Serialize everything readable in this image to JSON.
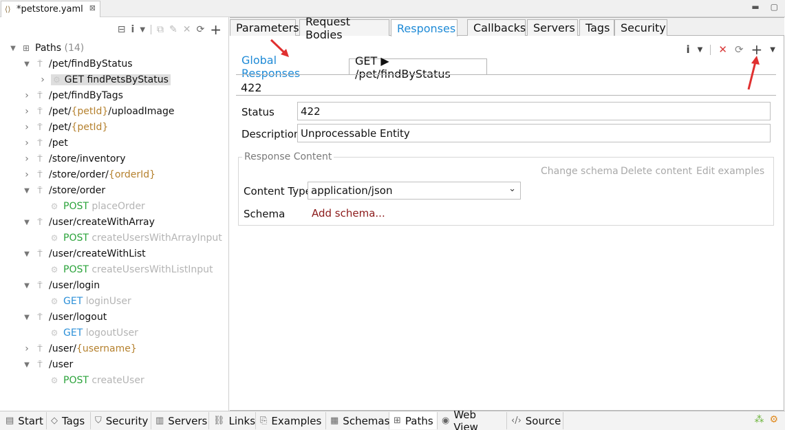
{
  "editor": {
    "tab_title": "*petstore.yaml",
    "close_glyph": "⊠"
  },
  "left": {
    "toolbar": [
      "collapse-all-icon",
      "info-icon",
      "dropdown-icon",
      "copy-icon",
      "edit-icon",
      "delete-icon",
      "refresh-icon",
      "add-icon"
    ],
    "root": {
      "label": "Paths",
      "count": "(14)"
    },
    "rows": [
      {
        "path_a": "/pet/findByStatus",
        "param": "",
        "path_b": "",
        "expanded": true
      },
      {
        "method": "GET",
        "op": "findPetsByStatus",
        "selected": true
      },
      {
        "path_a": "/pet/findByTags",
        "param": "",
        "path_b": ""
      },
      {
        "path_a": "/pet/",
        "param": "{petId}",
        "path_b": "/uploadImage"
      },
      {
        "path_a": "/pet/",
        "param": "{petId}",
        "path_b": ""
      },
      {
        "path_a": "/pet",
        "param": "",
        "path_b": ""
      },
      {
        "path_a": "/store/inventory",
        "param": "",
        "path_b": ""
      },
      {
        "path_a": "/store/order/",
        "param": "{orderId}",
        "path_b": ""
      },
      {
        "path_a": "/store/order",
        "param": "",
        "path_b": "",
        "expanded": true
      },
      {
        "method": "POST",
        "op": "placeOrder"
      },
      {
        "path_a": "/user/createWithArray",
        "param": "",
        "path_b": "",
        "expanded": true
      },
      {
        "method": "POST",
        "op": "createUsersWithArrayInput"
      },
      {
        "path_a": "/user/createWithList",
        "param": "",
        "path_b": "",
        "expanded": true
      },
      {
        "method": "POST",
        "op": "createUsersWithListInput"
      },
      {
        "path_a": "/user/login",
        "param": "",
        "path_b": "",
        "expanded": true
      },
      {
        "method": "GET",
        "op": "loginUser"
      },
      {
        "path_a": "/user/logout",
        "param": "",
        "path_b": "",
        "expanded": true
      },
      {
        "method": "GET",
        "op": "logoutUser"
      },
      {
        "path_a": "/user/",
        "param": "{username}",
        "path_b": ""
      },
      {
        "path_a": "/user",
        "param": "",
        "path_b": "",
        "expanded": true
      },
      {
        "method": "POST",
        "op": "createUser"
      }
    ]
  },
  "right": {
    "tabs": [
      "Parameters",
      "Request Bodies",
      "Responses",
      "Callbacks",
      "Servers",
      "Tags",
      "Security"
    ],
    "active_tab": "Responses",
    "sub_tabs": {
      "global": "Global Responses",
      "operation": "GET ▶ /pet/findByStatus"
    },
    "code_tab": "422",
    "status_label": "Status",
    "status_value": "422",
    "description_label": "Description",
    "description_value": "Unprocessable Entity",
    "group_title": "Response Content",
    "links": {
      "change_schema": "Change schema",
      "delete_content": "Delete content",
      "edit_examples": "Edit examples"
    },
    "content_type_label": "Content Type",
    "content_type_value": "application/json",
    "schema_label": "Schema",
    "add_schema": "Add schema..."
  },
  "bottom": {
    "tabs": [
      "Start",
      "Tags",
      "Security",
      "Servers",
      "Links",
      "Examples",
      "Schemas",
      "Paths",
      "Web View",
      "Source"
    ],
    "active": "Paths"
  },
  "colors": {
    "accent_blue": "#1e8ad6",
    "post_green": "#2aa33a",
    "get_blue": "#2b8fd8",
    "param_brown": "#b5812e",
    "link_dark_red": "#8b1a1a",
    "arrow_red": "#e03030"
  }
}
